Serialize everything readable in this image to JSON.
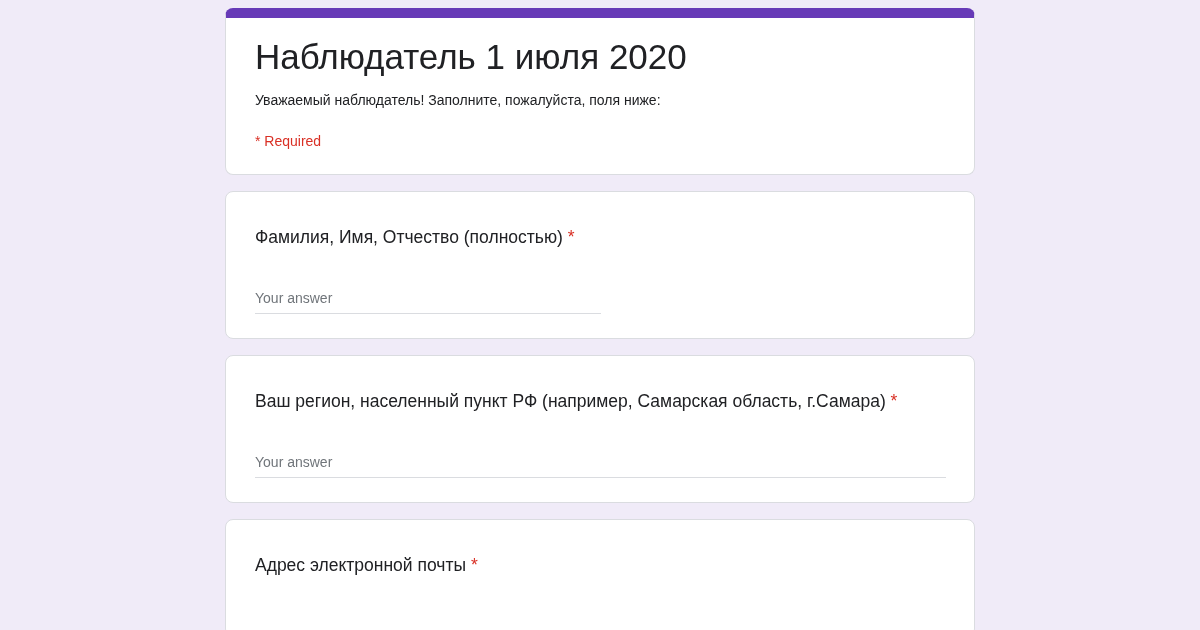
{
  "form": {
    "title": "Наблюдатель 1 июля 2020",
    "description": "Уважаемый наблюдатель! Заполните, пожалуйста, поля ниже:",
    "required_note": "* Required"
  },
  "questions": [
    {
      "label": "Фамилия, Имя, Отчество (полностью)",
      "required_mark": "*",
      "field": {
        "placeholder": "Your answer",
        "kind": "short"
      }
    },
    {
      "label": "Ваш регион, населенный пункт РФ (например, Самарская область, г.Самара)",
      "required_mark": "*",
      "field": {
        "placeholder": "Your answer",
        "kind": "long"
      }
    },
    {
      "label": "Адрес электронной почты",
      "required_mark": "*"
    }
  ]
}
